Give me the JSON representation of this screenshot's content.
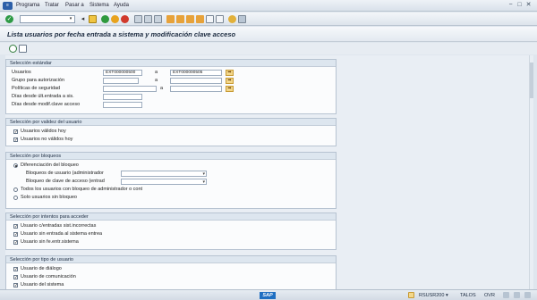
{
  "menubar": {
    "items": [
      "Programa",
      "Tratar",
      "Pasar a",
      "Sistema",
      "Ayuda"
    ],
    "window_controls": [
      "−",
      "□",
      "✕"
    ]
  },
  "toolbar": {
    "command_field": "",
    "icons": [
      "enter-icon",
      "save-icon",
      "back-icon",
      "exit-icon",
      "cancel-icon",
      "print-icon",
      "find-icon",
      "find-next-icon",
      "first-page-icon",
      "prev-page-icon",
      "next-page-icon",
      "last-page-icon",
      "new-session-icon",
      "shortcut-icon",
      "help-icon",
      "customize-icon"
    ]
  },
  "title": "Lista usuarios por fecha entrada a sistema y modificación clave acceso",
  "groups": {
    "seleccion_estandar": {
      "header": "Selección estándar",
      "usuarios_label": "Usuarios",
      "usuarios_from": "EXT000000500",
      "usuarios_to": "EXT000000505",
      "a_label": "a",
      "grupo_label": "Grupo para autorización",
      "politicas_label": "Políticas de seguridad",
      "dias_entrada_label": "Días desde últ.entrada a sis.",
      "dias_clave_label": "Días desde modif.clave acceso"
    },
    "validez": {
      "header": "Selección por validez del usuario",
      "validos_label": "Usuarios válidos hoy",
      "no_validos_label": "Usuarios no válidos hoy"
    },
    "bloqueos": {
      "header": "Selección por bloqueos",
      "diferenciacion_label": "Diferenciación del bloqueo",
      "bloqueo_admin_label": "Bloqueos de usuario (administrador",
      "bloqueo_clave_label": "Bloqueo de clave de acceso (entrad",
      "todos_label": "Todos los usuarios con bloqueo de administrador o cont",
      "solo_label": "Solo usuarios sin bloqueo"
    },
    "intentos": {
      "header": "Selección por intentos para acceder",
      "incorrectas_label": "Usuario c/entradas sist.incorrectas",
      "sin_entrada_label": "Usuario sin entrada al sistema entrea",
      "sin_fe_label": "Usuario sin fe.entr.sistema"
    },
    "tipo": {
      "header": "Selección por tipo de usuario",
      "dialogo_label": "Usuario de diálogo",
      "comunicacion_label": "Usuario de comunicación",
      "sistema_label": "Usuario del sistema"
    }
  },
  "status": {
    "logo": "SAP",
    "program": "RSUSR200",
    "server": "TALOS",
    "mode": "OVR"
  }
}
